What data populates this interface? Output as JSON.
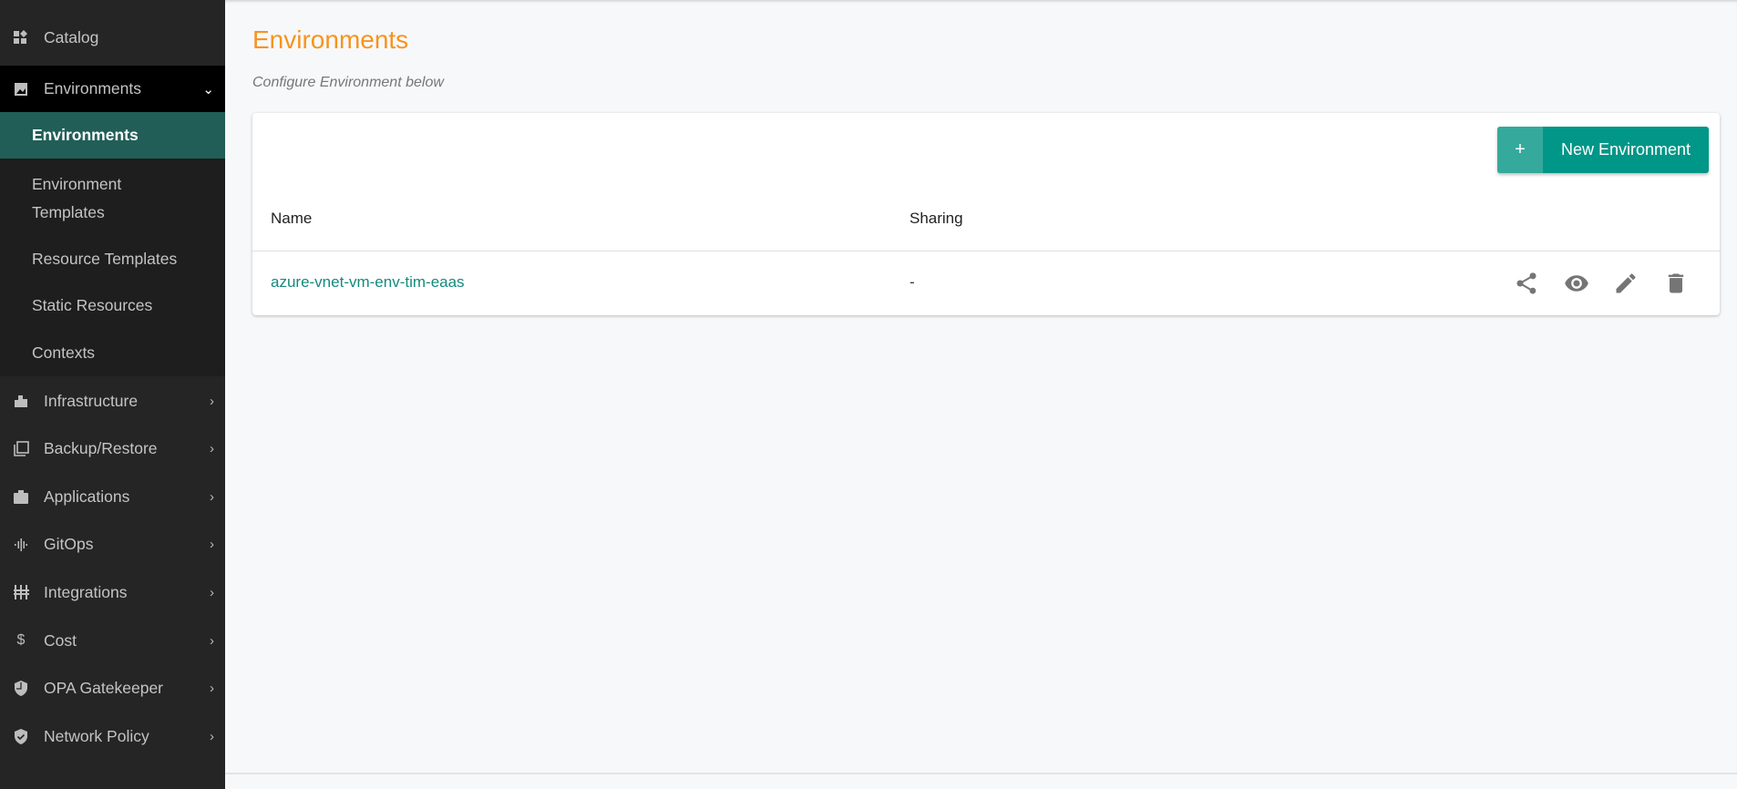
{
  "sidebar": {
    "catalog": {
      "label": "Catalog",
      "icon": "catalog-icon"
    },
    "environments": {
      "label": "Environments",
      "icon": "image-icon",
      "expanded": true,
      "children": [
        "Environments",
        "Environment Templates",
        "Resource Templates",
        "Static Resources",
        "Contexts"
      ],
      "active": "Environments"
    },
    "items": [
      {
        "label": "Infrastructure",
        "icon": "building-icon"
      },
      {
        "label": "Backup/Restore",
        "icon": "copy-icon"
      },
      {
        "label": "Applications",
        "icon": "briefcase-icon"
      },
      {
        "label": "GitOps",
        "icon": "waveform-icon"
      },
      {
        "label": "Integrations",
        "icon": "sliders-icon"
      },
      {
        "label": "Cost",
        "icon": "dollar-icon"
      },
      {
        "label": "OPA Gatekeeper",
        "icon": "shield-icon"
      },
      {
        "label": "Network Policy",
        "icon": "shield-check-icon"
      }
    ]
  },
  "main": {
    "title": "Environments",
    "subtitle": "Configure Environment below",
    "new_button": {
      "icon": "+",
      "label": "New Environment"
    },
    "table": {
      "columns": [
        "Name",
        "Sharing"
      ],
      "rows": [
        {
          "name": "azure-vnet-vm-env-tim-eaas",
          "sharing": "-"
        }
      ],
      "actions": [
        "share-icon",
        "view-icon",
        "edit-icon",
        "delete-icon"
      ]
    }
  },
  "colors": {
    "accent": "#009688",
    "title": "#f7941d",
    "active_nav": "#215e57",
    "link": "#138a7d"
  }
}
